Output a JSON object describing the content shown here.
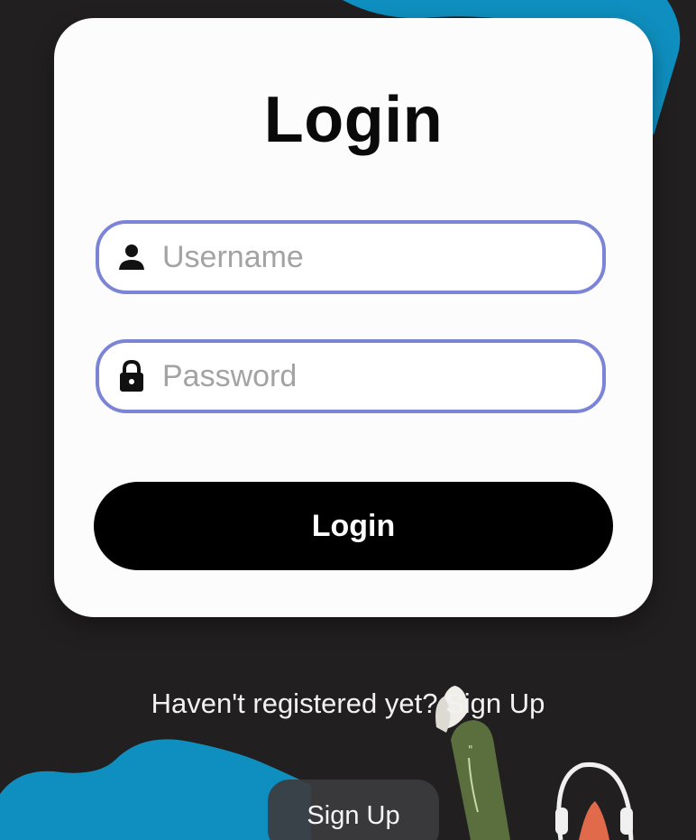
{
  "login": {
    "title": "Login",
    "username_placeholder": "Username",
    "password_placeholder": "Password",
    "login_button": "Login"
  },
  "footer": {
    "prompt": "Haven't registered yet? ",
    "link": "Sign Up",
    "signup_button": "Sign Up"
  },
  "icons": {
    "username": "person-icon",
    "password": "lock-icon"
  },
  "colors": {
    "background": "#221f21",
    "card": "#fdfcfd",
    "field_border": "#7c84d8",
    "accent_blue": "#0f8fbf",
    "button": "#000000"
  }
}
